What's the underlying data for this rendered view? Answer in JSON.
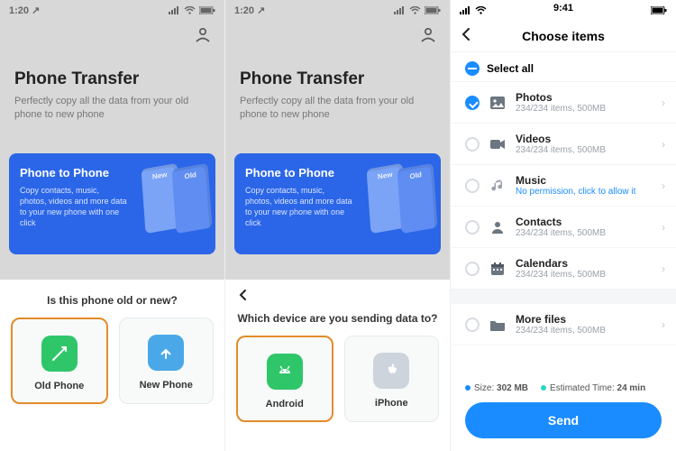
{
  "panel1": {
    "time": "1:20",
    "time_arrow": "↗",
    "title": "Phone Transfer",
    "subtitle": "Perfectly copy all the data from your old phone to new phone",
    "card": {
      "heading": "Phone to Phone",
      "desc": "Copy contacts, music, photos, videos and more data to your new phone with one click",
      "label_old": "Old",
      "label_new": "New"
    },
    "sheet": {
      "question": "Is this phone old or new?",
      "opt1": "Old Phone",
      "opt2": "New Phone"
    }
  },
  "panel2": {
    "time": "1:20",
    "time_arrow": "↗",
    "title": "Phone Transfer",
    "subtitle": "Perfectly copy all the data from your old phone to new phone",
    "card": {
      "heading": "Phone to Phone",
      "desc": "Copy contacts, music, photos, videos and more data to your new phone with one click",
      "label_old": "Old",
      "label_new": "New"
    },
    "sheet": {
      "question": "Which device are you sending data to?",
      "opt1": "Android",
      "opt2": "iPhone"
    }
  },
  "panel3": {
    "time": "9:41",
    "header": "Choose items",
    "select_all": "Select all",
    "items": [
      {
        "name": "Photos",
        "meta": "234/234 items, 500MB",
        "checked": true,
        "icon": "photo"
      },
      {
        "name": "Videos",
        "meta": "234/234 items, 500MB",
        "checked": false,
        "icon": "video"
      },
      {
        "name": "Music",
        "meta": "No permission,  click to allow it",
        "meta_blue": true,
        "checked": false,
        "icon": "music"
      },
      {
        "name": "Contacts",
        "meta": "234/234 items, 500MB",
        "checked": false,
        "icon": "contact"
      },
      {
        "name": "Calendars",
        "meta": "234/234 items, 500MB",
        "checked": false,
        "icon": "calendar"
      }
    ],
    "more": {
      "name": "More files",
      "meta": "234/234 items, 500MB"
    },
    "footer": {
      "size_label": "Size:",
      "size_value": "302 MB",
      "eta_label": "Estimated Time:",
      "eta_value": "24 min",
      "send": "Send"
    }
  }
}
